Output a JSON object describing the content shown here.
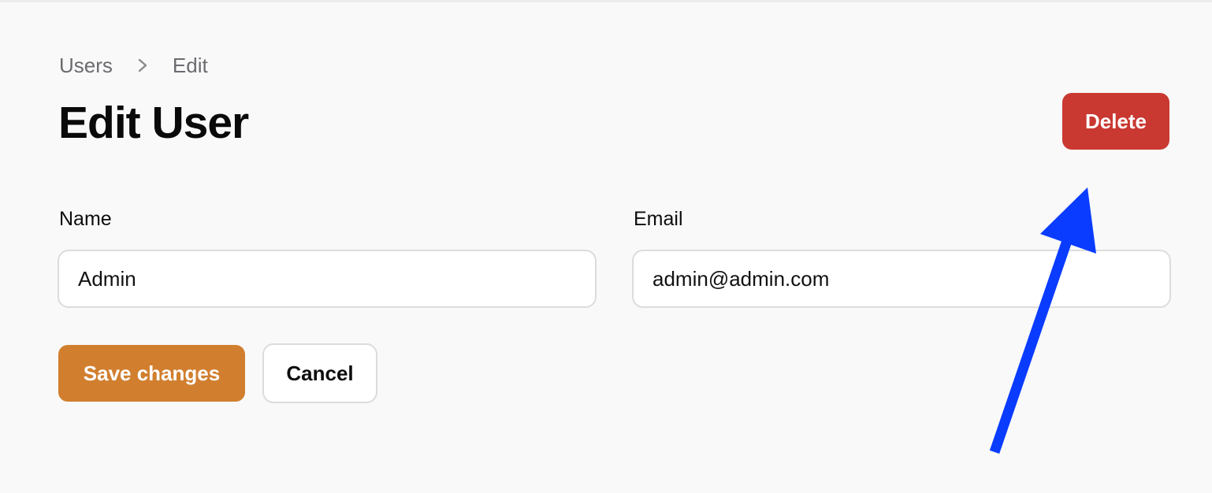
{
  "breadcrumb": {
    "items": [
      "Users",
      "Edit"
    ],
    "separator_icon": "chevron-right-icon"
  },
  "page": {
    "title": "Edit User"
  },
  "actions": {
    "delete_label": "Delete"
  },
  "form": {
    "name_label": "Name",
    "name_value": "Admin",
    "email_label": "Email",
    "email_value": "admin@admin.com",
    "save_label": "Save changes",
    "cancel_label": "Cancel"
  },
  "colors": {
    "background": "#f9f9f9",
    "delete": "#c93831",
    "save": "#d17f2f",
    "annotation_arrow": "#0a3cff"
  }
}
